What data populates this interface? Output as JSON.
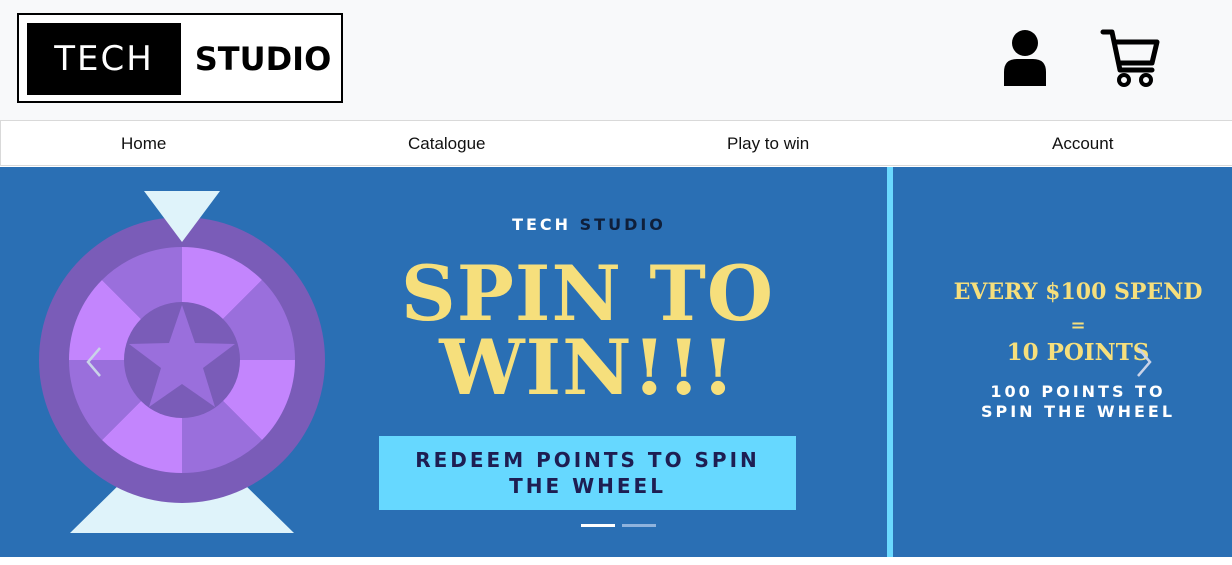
{
  "header": {
    "logo": {
      "left_text": "TECH",
      "right_text": "STUDIO"
    },
    "icons": {
      "account": "user-icon",
      "cart": "shopping-cart-icon"
    }
  },
  "nav": {
    "items": [
      {
        "label": "Home"
      },
      {
        "label": "Catalogue"
      },
      {
        "label": "Play to win"
      },
      {
        "label": "Account"
      }
    ]
  },
  "banner": {
    "slide": {
      "brand_left": "TECH",
      "brand_right": "STUDIO",
      "title_line1": "SPIN TO",
      "title_line2": "WIN!!!",
      "cta_line1": "REDEEM POINTS TO SPIN",
      "cta_line2": "THE WHEEL"
    },
    "side_slide": {
      "line1": "EVERY $100 SPEND",
      "equals": "=",
      "line2": "10 POINTS",
      "sub_line1": "100 POINTS TO",
      "sub_line2": "SPIN THE WHEEL"
    },
    "indicators": {
      "count": 2,
      "active_index": 0
    },
    "colors": {
      "background": "#2a6fb4",
      "accent_cyan": "#66d8ff",
      "title_yellow": "#f6df7c",
      "wheel_purple": "#7a5cb8"
    }
  }
}
